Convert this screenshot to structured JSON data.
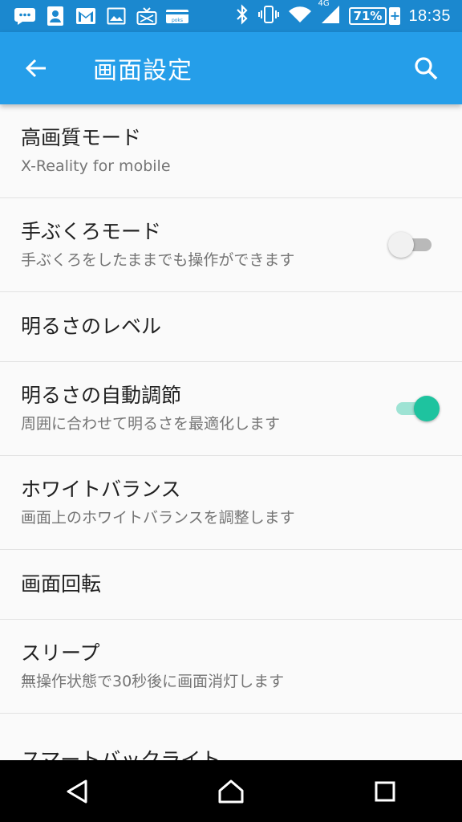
{
  "status_bar": {
    "icons_left": [
      "message-icon",
      "contact-icon",
      "gmail-icon",
      "gallery-icon",
      "tv-icon",
      "points-icon"
    ],
    "points_label": "poks",
    "network": "4G",
    "battery_percent": "71%",
    "clock": "18:35"
  },
  "app_bar": {
    "title": "画面設定"
  },
  "settings": [
    {
      "title": "高画質モード",
      "subtitle": "X-Reality for mobile"
    },
    {
      "title": "手ぶくろモード",
      "subtitle": "手ぶくろをしたままでも操作ができます",
      "toggle": false
    },
    {
      "title": "明るさのレベル"
    },
    {
      "title": "明るさの自動調節",
      "subtitle": "周囲に合わせて明るさを最適化します",
      "toggle": true
    },
    {
      "title": "ホワイトバランス",
      "subtitle": "画面上のホワイトバランスを調整します"
    },
    {
      "title": "画面回転"
    },
    {
      "title": "スリープ",
      "subtitle": "無操作状態で30秒後に画面消灯します"
    },
    {
      "title": "スマートバックライト"
    }
  ],
  "colors": {
    "status_bar": "#1b88cf",
    "app_bar": "#259ee9",
    "toggle_on": "#1ec39f"
  }
}
